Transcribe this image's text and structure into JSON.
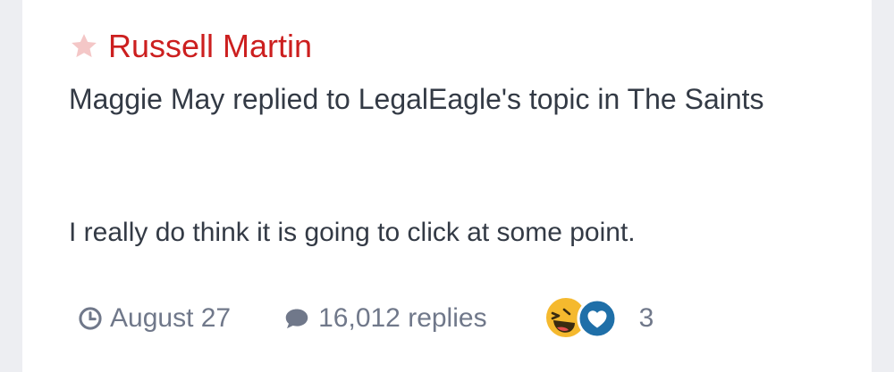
{
  "item": {
    "title": "Russell Martin",
    "activity": "Maggie May replied to LegalEagle's topic in The Saints",
    "snippet": "I really do think it is going to click at some point.",
    "date": "August 27",
    "replies": "16,012 replies",
    "reaction_count": "3"
  },
  "icons": {
    "featured": "star-icon",
    "date": "clock-icon",
    "replies": "speech-bubble-icon",
    "reactions": [
      "laughing-face-icon",
      "heart-icon"
    ]
  },
  "colors": {
    "title": "#cc1f1f",
    "body_text": "#333a45",
    "meta_text": "#70788a",
    "star": "#f4c7c7",
    "heart_badge": "#1f6fa8",
    "laugh_face": "#f5b92e"
  }
}
